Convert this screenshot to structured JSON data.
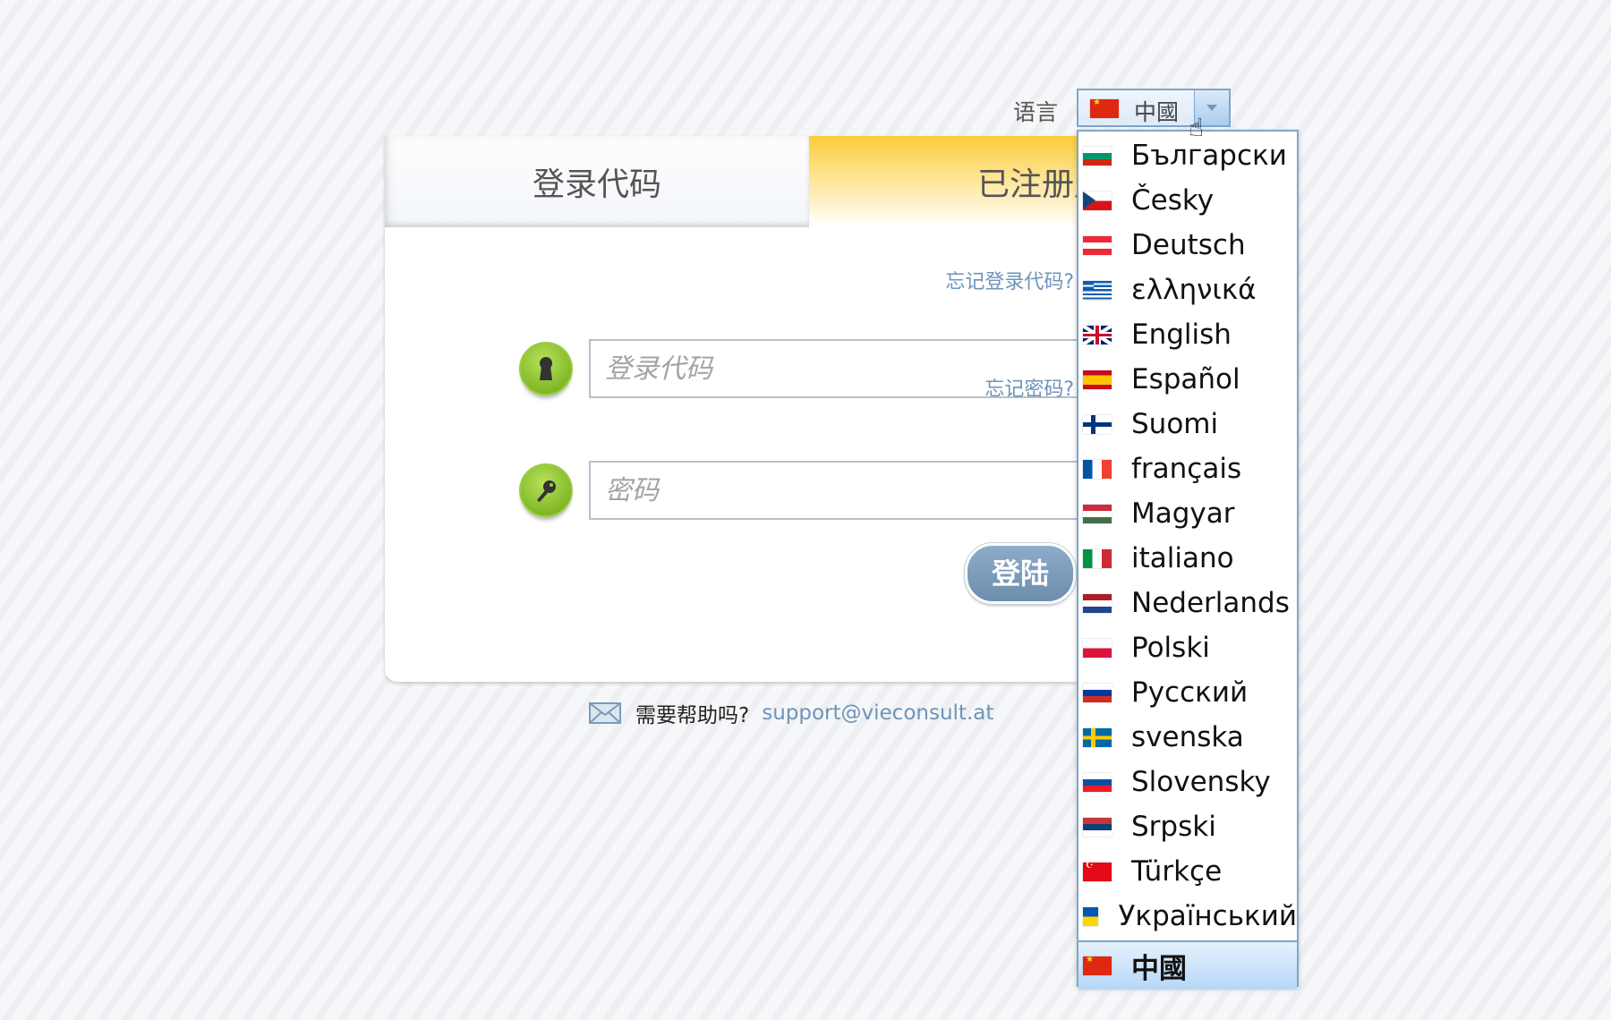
{
  "language_selector": {
    "label": "语言",
    "selected": "中國",
    "selected_flag": "cn",
    "options": [
      {
        "label": "Български",
        "flag": "bg"
      },
      {
        "label": "Česky",
        "flag": "cz"
      },
      {
        "label": "Deutsch",
        "flag": "at"
      },
      {
        "label": "ελληνικά",
        "flag": "gr"
      },
      {
        "label": "English",
        "flag": "gb"
      },
      {
        "label": "Español",
        "flag": "es"
      },
      {
        "label": "Suomi",
        "flag": "fi"
      },
      {
        "label": "français",
        "flag": "fr"
      },
      {
        "label": "Magyar",
        "flag": "hu"
      },
      {
        "label": "italiano",
        "flag": "it"
      },
      {
        "label": "Nederlands",
        "flag": "nl"
      },
      {
        "label": "Polski",
        "flag": "pl"
      },
      {
        "label": "Русский",
        "flag": "ru"
      },
      {
        "label": "svenska",
        "flag": "se"
      },
      {
        "label": "Slovensky",
        "flag": "sk"
      },
      {
        "label": "Srpski",
        "flag": "rs"
      },
      {
        "label": "Türkçe",
        "flag": "tr"
      },
      {
        "label": "Український",
        "flag": "ua"
      },
      {
        "label": "中國",
        "flag": "cn",
        "selected": true
      }
    ]
  },
  "tabs": [
    {
      "label": "登录代码",
      "active": false
    },
    {
      "label": "已注册用户",
      "active": true
    }
  ],
  "form": {
    "forgot_code": "忘记登录代码?",
    "code_placeholder": "登录代码",
    "forgot_password": "忘记密码?",
    "password_placeholder": "密码",
    "login_button": "登陆"
  },
  "footer": {
    "help_text": "需要帮助吗?",
    "email": "support@vieconsult.at"
  },
  "colors": {
    "accent_blue": "#6f93b8",
    "button": "#7b9bbb",
    "tab_active": "#fccd3a",
    "icon_green": "#8fc43a"
  }
}
